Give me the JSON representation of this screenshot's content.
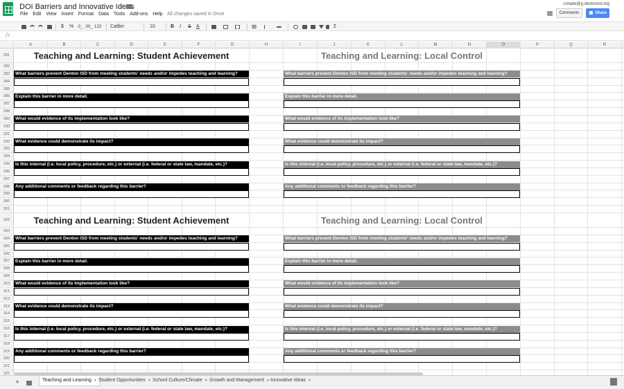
{
  "app": {
    "title": "DOI Barriers and Innovative Ideas",
    "saved_status": "All changes saved in Drive",
    "user_email": "cshade@g.dentonisd.org",
    "comments_label": "Comments",
    "share_label": "Share",
    "star_icon": "star-icon",
    "folder_icon": "folder-icon"
  },
  "menu": [
    "File",
    "Edit",
    "View",
    "Insert",
    "Format",
    "Data",
    "Tools",
    "Add-ons",
    "Help"
  ],
  "toolbar": {
    "zoom": "123",
    "font": "Calibri",
    "font_size": "10",
    "currency": "$",
    "percent": "%",
    "dec_dec": ".0_",
    "inc_dec": ".00_",
    "bold": "B",
    "italic": "I",
    "strike": "S",
    "textcolor": "A",
    "sum": "Σ"
  },
  "formula": {
    "fx": "fx"
  },
  "columns": [
    "A",
    "B",
    "C",
    "D",
    "E",
    "F",
    "G",
    "H",
    "I",
    "J",
    "K",
    "L",
    "M",
    "N",
    "O",
    "P",
    "Q",
    "R"
  ],
  "rows": [
    "281",
    "282",
    "283",
    "284",
    "285",
    "286",
    "287",
    "288",
    "289",
    "290",
    "291",
    "292",
    "293",
    "294",
    "295",
    "296",
    "297",
    "298",
    "299",
    "300",
    "301",
    "302",
    "303",
    "304",
    "305",
    "306",
    "307",
    "308",
    "309",
    "310",
    "311",
    "312",
    "313",
    "314",
    "315",
    "316",
    "317",
    "318",
    "319",
    "320",
    "321",
    "322"
  ],
  "sections": {
    "left_title": "Teaching and Learning: Student Achievement",
    "right_title": "Teaching and Learning: Local Control"
  },
  "questions": [
    "What barriers prevent Denton ISD from meeting students' needs and/or impedes teaching and learning?",
    "Explain this barrier in more detail.",
    "What would evidence of its implementation look like?",
    "What evidence could demonstrate its impact?",
    "Is this internal (i.e. local policy, procedure, etc.) or external (i.e. federal or state law, mandate, etc.)?",
    "Any additional comments or feedback regarding this barrier?"
  ],
  "sheets": [
    "Teaching and Learning",
    "Student Opportunities",
    "School Culture/Climate",
    "Growth and Management",
    "Innovative Ideas"
  ],
  "active_sheet": 0
}
